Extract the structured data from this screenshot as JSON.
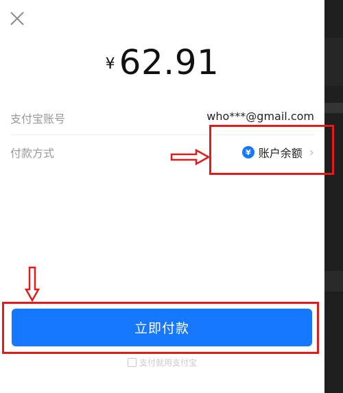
{
  "payment": {
    "currency_symbol": "¥",
    "amount": "62.91"
  },
  "account_row": {
    "label": "支付宝账号",
    "value": "who***@gmail.com"
  },
  "method_row": {
    "label": "付款方式",
    "coin_symbol": "¥",
    "value": "账户余额",
    "chevron": "›"
  },
  "pay_button": {
    "label": "立即付款"
  },
  "footer": {
    "text": "支付就用支付宝"
  },
  "colors": {
    "accent": "#1677ff",
    "highlight": "#e21a1a"
  },
  "icons": [
    "close-icon",
    "balance-coin-icon",
    "chevron-right-icon",
    "alipay-logo-icon",
    "arrow-right-icon",
    "arrow-down-icon"
  ]
}
